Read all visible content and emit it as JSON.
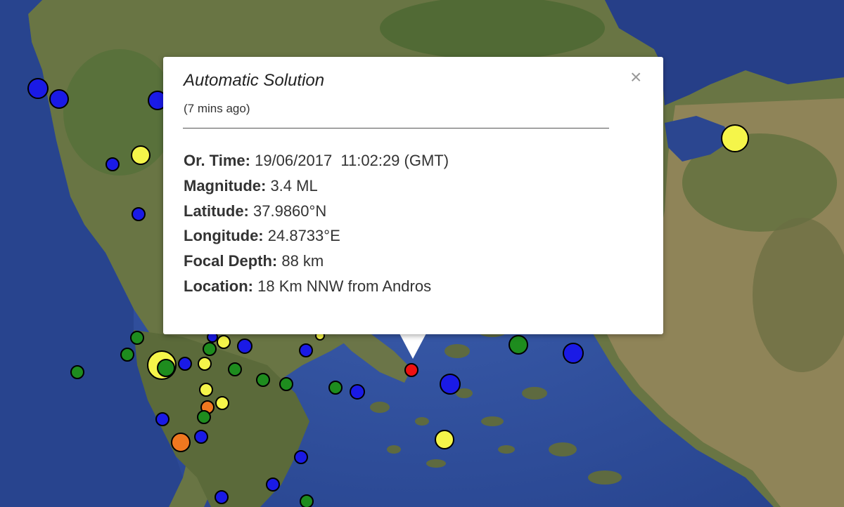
{
  "map": {
    "colors": {
      "sea": "#2f4f9a",
      "sea_dark": "#23408a",
      "land": "#6e7a4a",
      "land_green": "#4f6a35",
      "land_tan": "#9c8f68",
      "coast": "#8fa7c9"
    }
  },
  "popup": {
    "title": "Automatic Solution",
    "subtitle": "(7 mins ago)",
    "close_icon": "×",
    "fields": [
      {
        "label": "Or. Time:",
        "value": " 19/06/2017  11:02:29 (GMT)"
      },
      {
        "label": "Magnitude:",
        "value": " 3.4 ML"
      },
      {
        "label": "Latitude:",
        "value": " 37.9860°N"
      },
      {
        "label": "Longitude:",
        "value": " 24.8733°E"
      },
      {
        "label": "Focal Depth:",
        "value": " 88 km"
      },
      {
        "label": "Location:",
        "value": " 18 Km NNW from Andros"
      }
    ]
  },
  "markers": {
    "colors": {
      "blue": "#1a1ae6",
      "yellow": "#f5f54a",
      "green": "#1e8c1e",
      "orange": "#f07820",
      "red": "#ee1111"
    }
  }
}
